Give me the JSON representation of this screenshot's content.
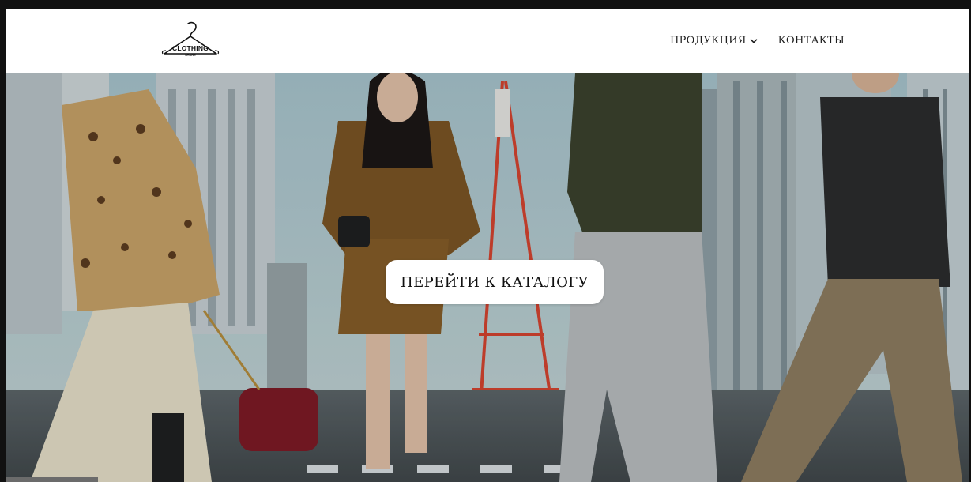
{
  "header": {
    "logo": {
      "text": "CLOTHING",
      "subtext": "STORE",
      "icon": "hanger-icon"
    },
    "nav": [
      {
        "label": "ПРОДУКЦИЯ",
        "icon": "chevron-down-icon"
      },
      {
        "label": "КОНТАКТЫ"
      }
    ]
  },
  "hero": {
    "cta_label": "ПЕРЕЙТИ К КАТАЛОГУ",
    "image_subject": "hero-photo"
  },
  "colors": {
    "background": "#ffffff",
    "text": "#1d1d1d",
    "cta_bg": "#ffffff",
    "border": "#111111"
  }
}
